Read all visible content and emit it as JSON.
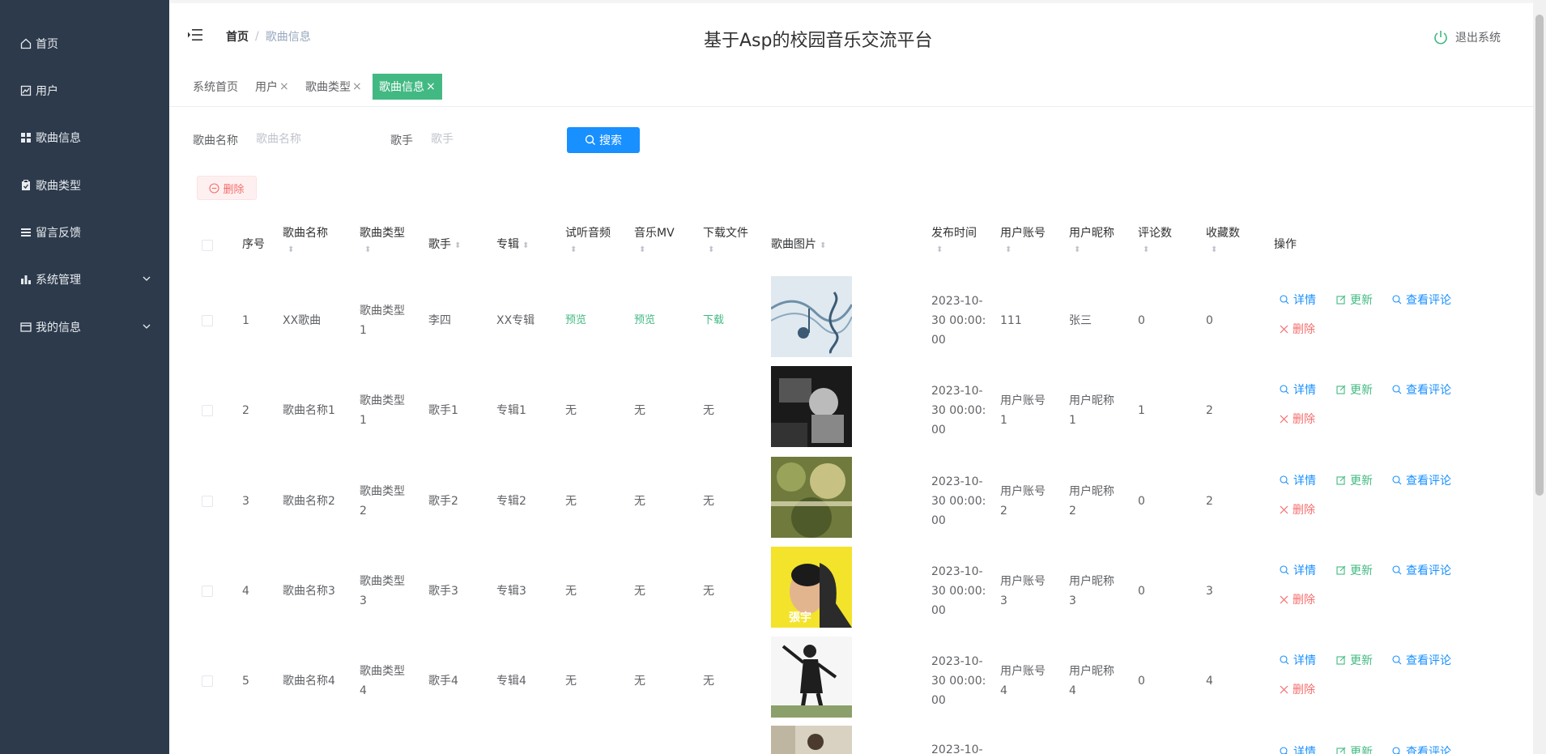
{
  "sidebar": {
    "items": [
      {
        "label": "首页",
        "icon": "home-icon"
      },
      {
        "label": "用户",
        "icon": "chart-icon"
      },
      {
        "label": "歌曲信息",
        "icon": "grid-icon"
      },
      {
        "label": "歌曲类型",
        "icon": "clipboard-icon"
      },
      {
        "label": "留言反馈",
        "icon": "list-icon"
      },
      {
        "label": "系统管理",
        "icon": "bar-chart-icon"
      },
      {
        "label": "我的信息",
        "icon": "card-icon"
      }
    ]
  },
  "header": {
    "breadcrumb_home": "首页",
    "breadcrumb_sep": "/",
    "breadcrumb_current": "歌曲信息",
    "title": "基于Asp的校园音乐交流平台",
    "logout": "退出系统"
  },
  "tags": [
    {
      "label": "系统首页",
      "closable": false
    },
    {
      "label": "用户",
      "closable": true
    },
    {
      "label": "歌曲类型",
      "closable": true
    },
    {
      "label": "歌曲信息",
      "closable": true,
      "active": true
    }
  ],
  "search": {
    "name_label": "歌曲名称",
    "name_placeholder": "歌曲名称",
    "singer_label": "歌手",
    "singer_placeholder": "歌手",
    "button": "搜索",
    "delete_button": "删除"
  },
  "table": {
    "headers": {
      "index": "序号",
      "name": "歌曲名称",
      "type": "歌曲类型",
      "singer": "歌手",
      "album": "专辑",
      "audio": "试听音频",
      "mv": "音乐MV",
      "file": "下载文件",
      "image": "歌曲图片",
      "time": "发布时间",
      "account": "用户账号",
      "nickname": "用户昵称",
      "comments": "评论数",
      "favorites": "收藏数",
      "ops": "操作"
    },
    "actions": {
      "detail": "详情",
      "update": "更新",
      "comment": "查看评论",
      "delete": "删除"
    },
    "rows": [
      {
        "index": "1",
        "name": "XX歌曲",
        "type_a": "歌曲类型",
        "type_b": "1",
        "singer": "李四",
        "album": "XX专辑",
        "audio": "预览",
        "mv": "预览",
        "file": "下载",
        "time_a": "2023-10-",
        "time_b": "30 00:00:",
        "time_c": "00",
        "account_a": "111",
        "account_b": "",
        "nick_a": "张三",
        "nick_b": "",
        "comments": "0",
        "favorites": "0"
      },
      {
        "index": "2",
        "name": "歌曲名称1",
        "type_a": "歌曲类型",
        "type_b": "1",
        "singer": "歌手1",
        "album": "专辑1",
        "audio": "无",
        "mv": "无",
        "file": "无",
        "time_a": "2023-10-",
        "time_b": "30 00:00:",
        "time_c": "00",
        "account_a": "用户账号",
        "account_b": "1",
        "nick_a": "用户昵称",
        "nick_b": "1",
        "comments": "1",
        "favorites": "2"
      },
      {
        "index": "3",
        "name": "歌曲名称2",
        "type_a": "歌曲类型",
        "type_b": "2",
        "singer": "歌手2",
        "album": "专辑2",
        "audio": "无",
        "mv": "无",
        "file": "无",
        "time_a": "2023-10-",
        "time_b": "30 00:00:",
        "time_c": "00",
        "account_a": "用户账号",
        "account_b": "2",
        "nick_a": "用户昵称",
        "nick_b": "2",
        "comments": "0",
        "favorites": "2"
      },
      {
        "index": "4",
        "name": "歌曲名称3",
        "type_a": "歌曲类型",
        "type_b": "3",
        "singer": "歌手3",
        "album": "专辑3",
        "audio": "无",
        "mv": "无",
        "file": "无",
        "time_a": "2023-10-",
        "time_b": "30 00:00:",
        "time_c": "00",
        "account_a": "用户账号",
        "account_b": "3",
        "nick_a": "用户昵称",
        "nick_b": "3",
        "comments": "0",
        "favorites": "3"
      },
      {
        "index": "5",
        "name": "歌曲名称4",
        "type_a": "歌曲类型",
        "type_b": "4",
        "singer": "歌手4",
        "album": "专辑4",
        "audio": "无",
        "mv": "无",
        "file": "无",
        "time_a": "2023-10-",
        "time_b": "30 00:00:",
        "time_c": "00",
        "account_a": "用户账号",
        "account_b": "4",
        "nick_a": "用户昵称",
        "nick_b": "4",
        "comments": "0",
        "favorites": "4"
      }
    ],
    "partial_row_time": "2023-10-"
  },
  "album_art_text": {
    "row4_name": "張宇"
  },
  "colors": {
    "sidebar_bg": "#2d3a4b",
    "accent_green": "#42b983",
    "primary_blue": "#1890ff",
    "danger_red": "#f56c6c"
  }
}
